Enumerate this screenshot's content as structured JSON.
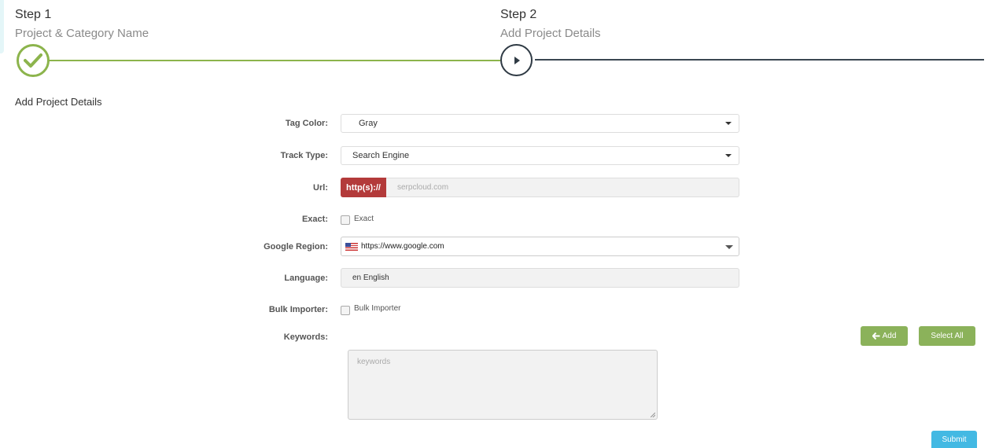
{
  "steps": [
    {
      "title": "Step 1",
      "subtitle": "Project & Category Name"
    },
    {
      "title": "Step 2",
      "subtitle": "Add Project Details"
    }
  ],
  "section_title": "Add Project Details",
  "form": {
    "tag_color": {
      "label": "Tag Color:",
      "value": "Gray"
    },
    "track_type": {
      "label": "Track Type:",
      "value": "Search Engine"
    },
    "url": {
      "label": "Url:",
      "prefix": "http(s)://",
      "placeholder": "serpcloud.com"
    },
    "exact": {
      "label": "Exact:",
      "checkbox_label": "Exact"
    },
    "google_region": {
      "label": "Google Region:",
      "value": "https://www.google.com"
    },
    "language": {
      "label": "Language:",
      "value": "en English"
    },
    "bulk_importer": {
      "label": "Bulk Importer:",
      "checkbox_label": "Bulk Importer"
    },
    "keywords": {
      "label": "Keywords:",
      "placeholder": "keywords"
    }
  },
  "buttons": {
    "add": "Add",
    "select_all": "Select All",
    "submit": "Submit"
  },
  "colors": {
    "complete_green": "#8cb44c",
    "url_prefix_red": "#b33a3a",
    "button_green": "#8bb25a",
    "submit_blue": "#43b9e3"
  }
}
